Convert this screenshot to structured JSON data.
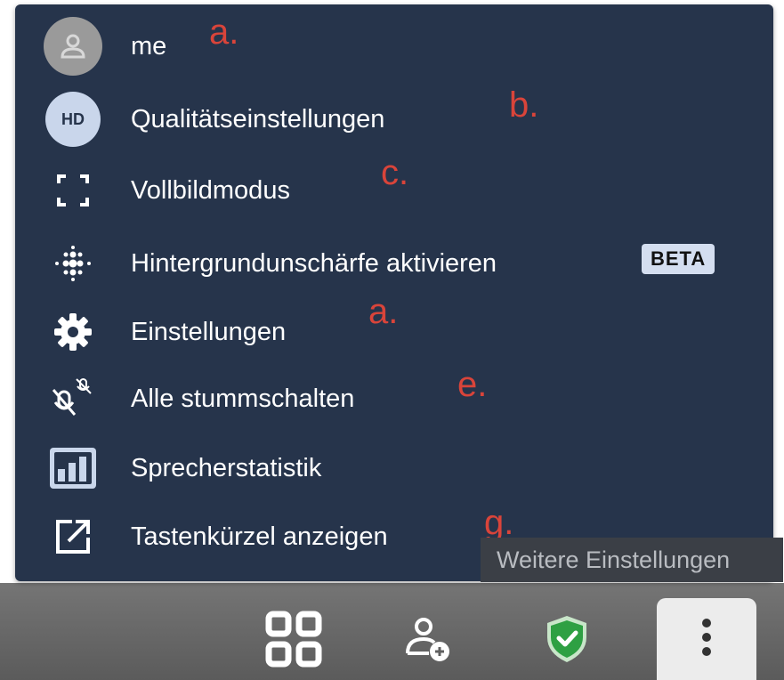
{
  "menu": {
    "items": [
      {
        "label": "me",
        "icon": "avatar-icon"
      },
      {
        "label": "Qualitätseinstellungen",
        "icon": "hd-icon",
        "icon_text": "HD"
      },
      {
        "label": "Vollbildmodus",
        "icon": "fullscreen-icon"
      },
      {
        "label": "Hintergrundunschärfe aktivieren",
        "icon": "blur-icon",
        "badge": "BETA"
      },
      {
        "label": "Einstellungen",
        "icon": "gear-icon"
      },
      {
        "label": "Alle stummschalten",
        "icon": "mute-all-icon"
      },
      {
        "label": "Sprecherstatistik",
        "icon": "speaker-stats-icon"
      },
      {
        "label": "Tastenkürzel anzeigen",
        "icon": "external-link-icon"
      }
    ]
  },
  "annotations": [
    "a.",
    "b.",
    "c.",
    "a.",
    "e.",
    "g."
  ],
  "tooltip": "Weitere Einstellungen",
  "toolbar": {
    "buttons": [
      "tile-view-icon",
      "invite-icon",
      "security-shield-icon",
      "more-dots-icon"
    ]
  },
  "colors": {
    "menu_bg": "#26344b",
    "text": "#ffffff",
    "annotation": "#d9443a",
    "shield": "#2ea043",
    "badge_bg": "#d4def0"
  }
}
